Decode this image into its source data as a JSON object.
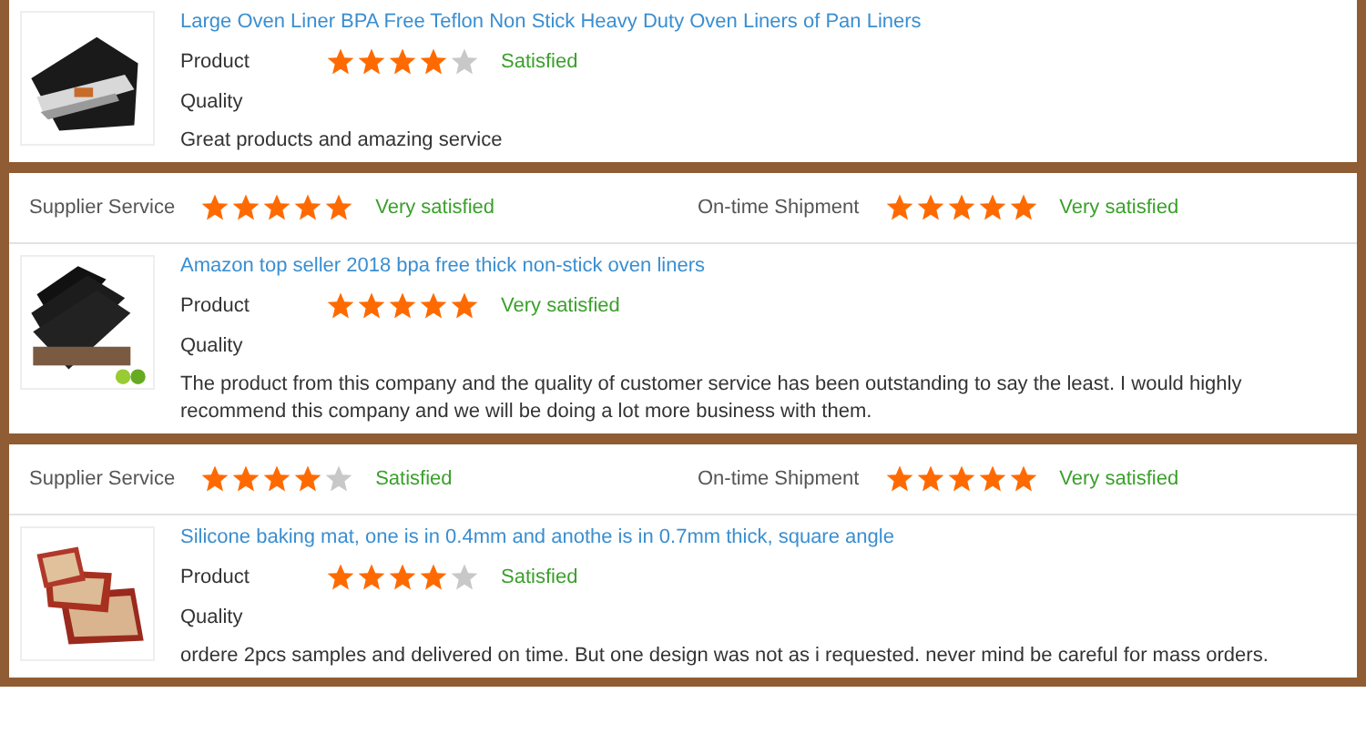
{
  "reviews": [
    {
      "title": "Large Oven Liner BPA Free Teflon Non Stick Heavy Duty Oven Liners of Pan Liners",
      "image": {
        "kind": "picture"
      },
      "product_rating": {
        "label": "Product",
        "stars": 4,
        "verdict": "Satisfied"
      },
      "quality_label": "Quality",
      "comment": "Great products and amazing service"
    },
    {
      "ratings": [
        {
          "label": "Supplier Service",
          "stars": 5,
          "verdict": "Very satisfied"
        },
        {
          "label": "On-time Shipment",
          "stars": 5,
          "verdict": "Very satisfied"
        }
      ],
      "title": "Amazon top seller 2018 bpa free thick non-stick oven liners",
      "image": {
        "kind": "picture"
      },
      "product_rating": {
        "label": "Product",
        "stars": 5,
        "verdict": "Very satisfied"
      },
      "quality_label": "Quality",
      "comment": "The product from this company and the quality of customer service has been outstanding to say the least. I would highly recommend this company and we will be doing a lot more business with them."
    },
    {
      "ratings": [
        {
          "label": "Supplier Service",
          "stars": 4,
          "verdict": "Satisfied"
        },
        {
          "label": "On-time Shipment",
          "stars": 5,
          "verdict": "Very satisfied"
        }
      ],
      "title": "Silicone baking mat, one is in 0.4mm and anothe is in 0.7mm thick, square angle",
      "image": {
        "kind": "picture"
      },
      "product_rating": {
        "label": "Product",
        "stars": 4,
        "verdict": "Satisfied"
      },
      "quality_label": "Quality",
      "comment": "ordere 2pcs samples and delivered on time. But one design was not as i requested. never mind be careful for mass orders."
    }
  ]
}
